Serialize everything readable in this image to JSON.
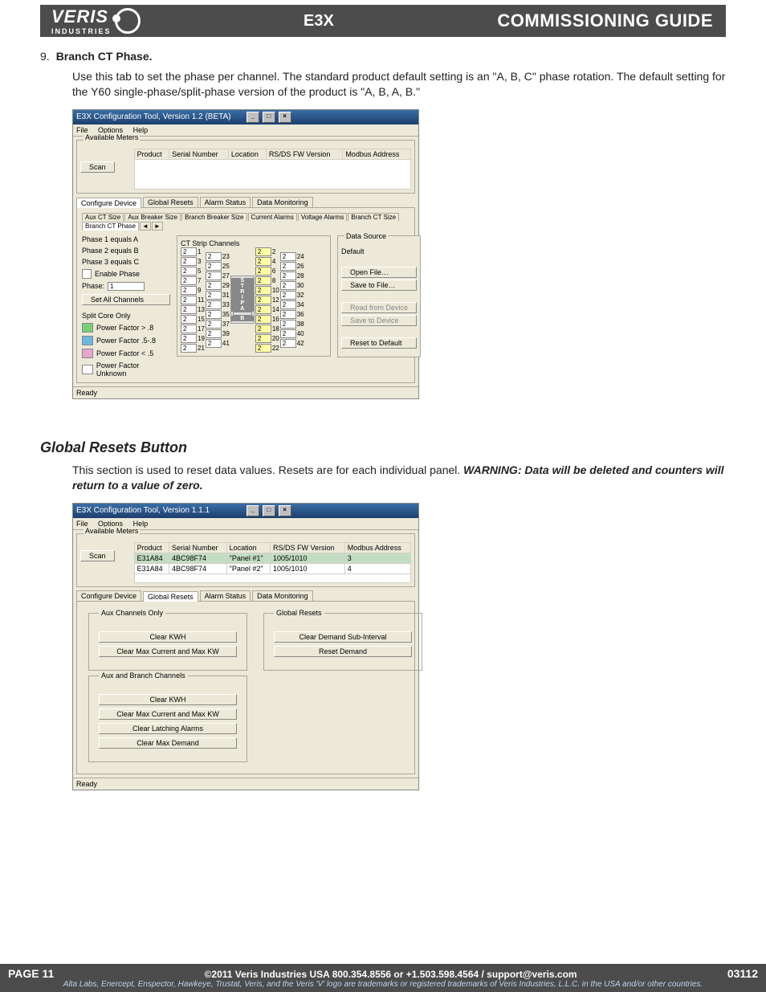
{
  "header": {
    "brand": "VERIS",
    "brand_sub": "INDUSTRIES",
    "product": "E3X",
    "doctitle": "COMMISSIONING GUIDE"
  },
  "section1": {
    "num": "9.",
    "title": "Branch CT Phase.",
    "body": "Use this tab to set the phase per channel. The standard product default setting is an \"A, B, C\" phase rotation. The default setting for the Y60 single-phase/split-phase version of the product is \"A, B, A, B.\""
  },
  "win1": {
    "title": "E3X Configuration Tool, Version 1.2 (BETA)",
    "menu": [
      "File",
      "Options",
      "Help"
    ],
    "available": "Available Meters",
    "scan": "Scan",
    "cols": [
      "Product",
      "Serial Number",
      "Location",
      "RS/DS FW Version",
      "Modbus Address"
    ],
    "tabs": [
      "Configure Device",
      "Global Resets",
      "Alarm Status",
      "Data Monitoring"
    ],
    "activeTab": "Configure Device",
    "subtabs": [
      "Aux CT Size",
      "Aux Breaker Size",
      "Branch Breaker Size",
      "Current Alarms",
      "Voltage Alarms",
      "Branch CT Size",
      "Branch CT Phase"
    ],
    "activeSubtab": "Branch CT Phase",
    "phases": [
      "Phase 1 equals A",
      "Phase 2 equals B",
      "Phase 3 equals C"
    ],
    "enablePhase": "Enable Phase",
    "phaseLabel": "Phase:",
    "phaseVal": "1",
    "setall": "Set All Channels",
    "splitcore": "Split Core Only",
    "legend": [
      {
        "c": "#78cf78",
        "t": "Power Factor > .8"
      },
      {
        "c": "#6cb6e0",
        "t": "Power Factor .5-.8"
      },
      {
        "c": "#e6a6cc",
        "t": "Power Factor < .5"
      },
      {
        "c": "#ffffff",
        "t": "Power Factor Unknown"
      }
    ],
    "ctstripTitle": "CT Strip Channels",
    "leftOdd": [
      1,
      3,
      5,
      7,
      9,
      11,
      13,
      15,
      17,
      19,
      21
    ],
    "leftEven": [
      23,
      25,
      27,
      29,
      31,
      33,
      35,
      37,
      39,
      41
    ],
    "midLetters": [
      "S",
      "T",
      "R",
      "I",
      "P",
      "A",
      "",
      "B"
    ],
    "rightA": [
      2,
      4,
      6,
      8,
      10,
      12,
      14,
      16,
      18,
      20,
      22
    ],
    "rightB": [
      24,
      26,
      28,
      30,
      32,
      34,
      36,
      38,
      40,
      42
    ],
    "dsTitle": "Data Source",
    "dsDefault": "Default",
    "openfile": "Open File…",
    "savefile": "Save to File…",
    "readdev": "Read from Device",
    "savedev": "Save to Device",
    "reset": "Reset to Default",
    "status": "Ready"
  },
  "section2": {
    "title": "Global Resets Button",
    "body_pre": "This section is used to reset data values. Resets are for each individual panel. ",
    "warn": "WARNING:  Data will be deleted and counters will return to a value of zero."
  },
  "win2": {
    "title": "E3X Configuration Tool, Version 1.1.1",
    "menu": [
      "File",
      "Options",
      "Help"
    ],
    "available": "Available Meters",
    "scan": "Scan",
    "cols": [
      "Product",
      "Serial Number",
      "Location",
      "RS/DS FW Version",
      "Modbus Address"
    ],
    "rows": [
      [
        "E31A84",
        "4BC98F74",
        "\"Panel #1\"",
        "1005/1010",
        "3"
      ],
      [
        "E31A84",
        "4BC98F74",
        "\"Panel #2\"",
        "1005/1010",
        "4"
      ]
    ],
    "tabs": [
      "Configure Device",
      "Global Resets",
      "Alarm Status",
      "Data Monitoring"
    ],
    "activeTab": "Global Resets",
    "aux": "Aux Channels Only",
    "auxbtns": [
      "Clear KWH",
      "Clear Max Current and Max KW"
    ],
    "global": "Global Resets",
    "globalbtns": [
      "Clear Demand Sub-Interval",
      "Reset Demand"
    ],
    "both": "Aux and Branch Channels",
    "bothbtns": [
      "Clear KWH",
      "Clear Max Current and Max KW",
      "Clear Latching Alarms",
      "Clear Max Demand"
    ],
    "status": "Ready"
  },
  "footer": {
    "page": "PAGE 11",
    "center": "©2011 Veris Industries   USA 800.354.8556 or +1.503.598.4564 / support@veris.com",
    "rev": "03112",
    "legal": "Alta Labs, Enercept, Enspector, Hawkeye, Trustat, Veris, and the Veris 'V' logo are trademarks or registered trademarks of  Veris Industries, L.L.C. in the USA and/or other countries."
  }
}
